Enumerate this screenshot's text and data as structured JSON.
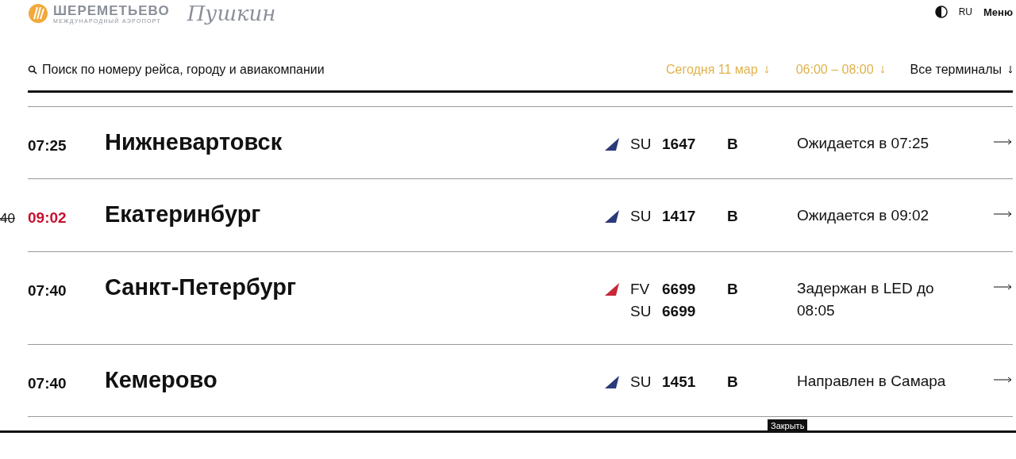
{
  "header": {
    "logo_title": "ШЕРЕМЕТЬЕВО",
    "logo_subtitle": "МЕЖДУНАРОДНЫЙ АЭРОПОРТ",
    "logo_script": "Пушкин",
    "language": "RU",
    "menu": "Меню"
  },
  "filters": {
    "search_placeholder": "Поиск по номеру рейса, городу и авиакомпании",
    "date": "Сегодня 11 мар",
    "time_range": "06:00 – 08:00",
    "terminals": "Все терминалы"
  },
  "flights": [
    {
      "time": "07:25",
      "delayed": false,
      "city": "Нижневартовск",
      "terminal": "B",
      "status": "Ожидается в 07:25",
      "codes": [
        {
          "airline": "SU",
          "number": "1647",
          "color": "#2a3a7a"
        }
      ]
    },
    {
      "old_time": "40",
      "time": "09:02",
      "delayed": true,
      "city": "Екатеринбург",
      "terminal": "B",
      "status": "Ожидается в 09:02",
      "codes": [
        {
          "airline": "SU",
          "number": "1417",
          "color": "#2a3a7a"
        }
      ]
    },
    {
      "time": "07:40",
      "delayed": false,
      "city": "Санкт-Петербург",
      "terminal": "B",
      "status": "Задержан в LED до 08:05",
      "codes": [
        {
          "airline": "FV",
          "number": "6699",
          "color": "#c8283a"
        },
        {
          "airline": "SU",
          "number": "6699"
        }
      ]
    },
    {
      "time": "07:40",
      "delayed": false,
      "city": "Кемерово",
      "terminal": "B",
      "status": "Направлен в Самара",
      "codes": [
        {
          "airline": "SU",
          "number": "1451",
          "color": "#2a3a7a"
        }
      ]
    }
  ],
  "close_label": "Закрыть"
}
